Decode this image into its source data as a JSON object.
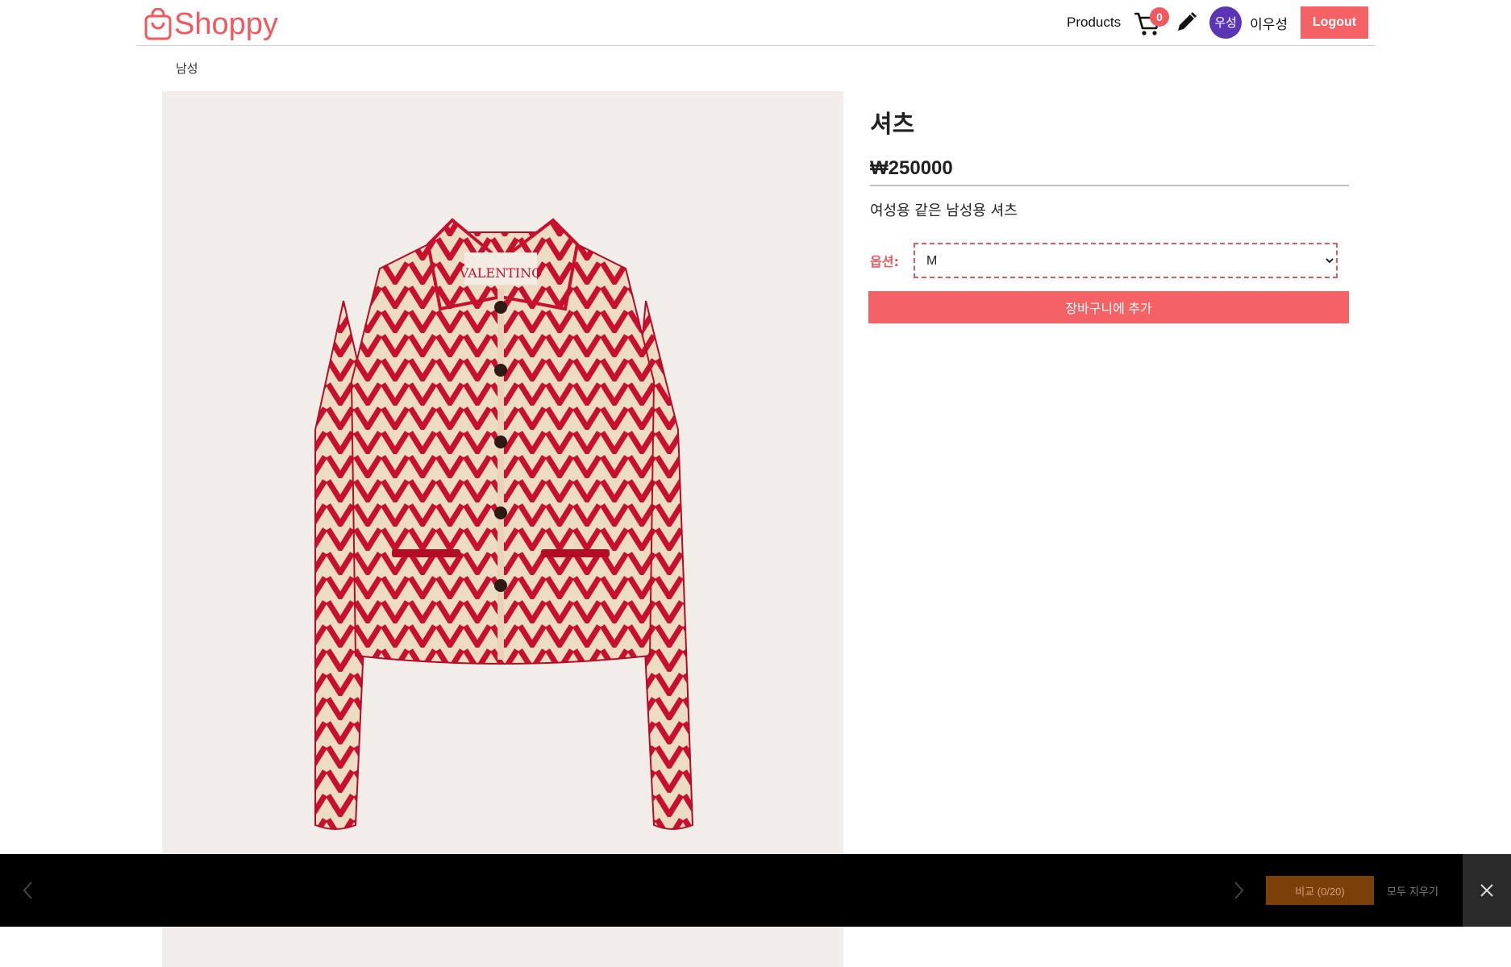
{
  "header": {
    "logo_text": "Shoppy",
    "nav_products": "Products",
    "cart_count": "0",
    "avatar_initials": "우성",
    "username": "이우성",
    "logout_label": "Logout"
  },
  "breadcrumb": "남성",
  "product": {
    "title": "셔츠",
    "price": "₩250000",
    "description": "여성용 같은 남성용 셔츠",
    "image_label": "VALENTINO",
    "option_label": "옵션:",
    "selected_option": "M",
    "add_to_cart_label": "장바구니에 추가"
  },
  "compare_bar": {
    "compare_label": "비교 (0/20)",
    "clear_all_label": "모두 지우기"
  },
  "colors": {
    "accent": "#f46266",
    "avatar": "#5b36b4",
    "image_bg": "#f1eeea",
    "jacket_red": "#c8102e",
    "jacket_base": "#ecdcc4"
  },
  "icons": [
    "shopping-bag-icon",
    "cart-icon",
    "pencil-icon",
    "chevron-left-icon",
    "chevron-right-icon",
    "close-icon"
  ]
}
